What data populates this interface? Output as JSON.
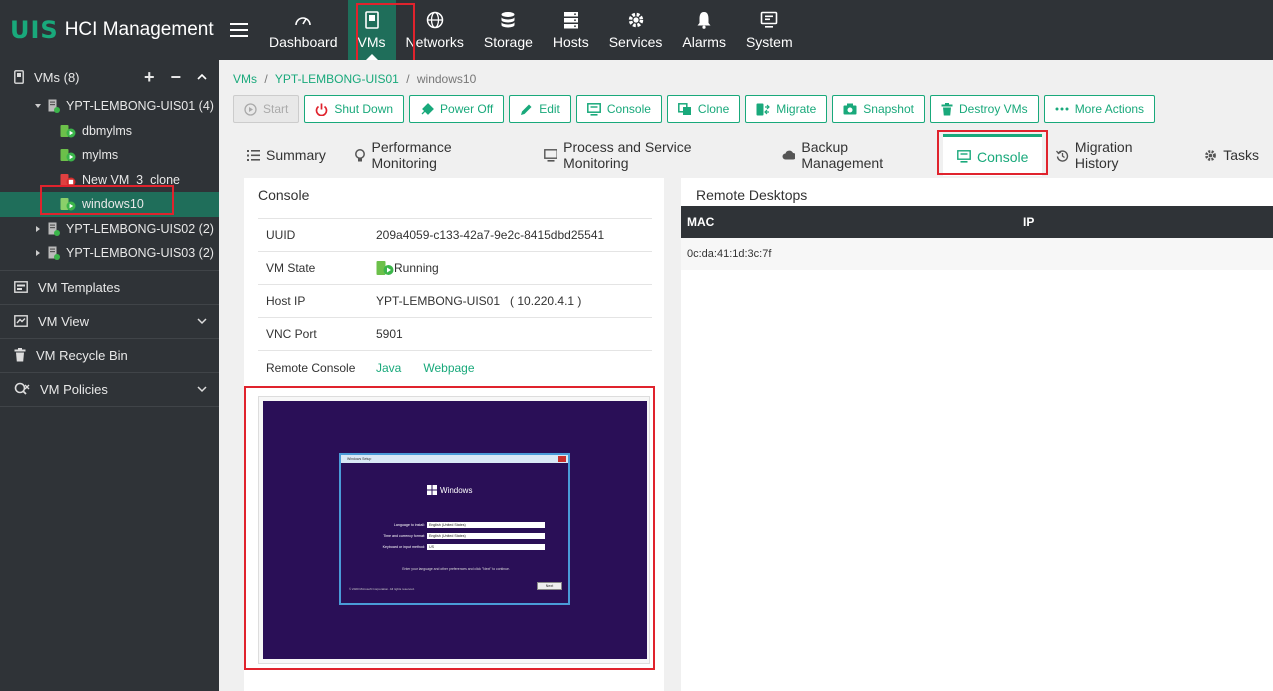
{
  "app": {
    "logo_mark": "UIS",
    "title": "HCI Management"
  },
  "nav": [
    {
      "label": "Dashboard",
      "icon": "dashboard-icon"
    },
    {
      "label": "VMs",
      "icon": "vm-icon",
      "active": true
    },
    {
      "label": "Networks",
      "icon": "globe-icon"
    },
    {
      "label": "Storage",
      "icon": "database-icon"
    },
    {
      "label": "Hosts",
      "icon": "server-icon"
    },
    {
      "label": "Services",
      "icon": "gear-icon"
    },
    {
      "label": "Alarms",
      "icon": "bell-icon"
    },
    {
      "label": "System",
      "icon": "monitor-icon"
    }
  ],
  "sidebar": {
    "vms_label": "VMs (8)",
    "add": "+",
    "remove": "−",
    "hosts": [
      {
        "label": "YPT-LEMBONG-UIS01 (4)",
        "expanded": true
      },
      {
        "label": "YPT-LEMBONG-UIS02 (2)",
        "expanded": false
      },
      {
        "label": "YPT-LEMBONG-UIS03 (2)",
        "expanded": false
      }
    ],
    "vms": [
      {
        "label": "dbmylms",
        "state": "running"
      },
      {
        "label": "mylms",
        "state": "running"
      },
      {
        "label": "New VM_3_clone",
        "state": "stopped"
      },
      {
        "label": "windows10",
        "state": "running",
        "selected": true
      }
    ],
    "sections": [
      {
        "label": "VM Templates",
        "icon": "template-icon"
      },
      {
        "label": "VM View",
        "icon": "view-icon"
      },
      {
        "label": "VM Recycle Bin",
        "icon": "trash-icon"
      },
      {
        "label": "VM Policies",
        "icon": "policy-icon"
      }
    ]
  },
  "breadcrumb": {
    "root": "VMs",
    "sep": "/",
    "host": "YPT-LEMBONG-UIS01",
    "current": "windows10"
  },
  "toolbar": [
    "Start",
    "Shut Down",
    "Power Off",
    "Edit",
    "Console",
    "Clone",
    "Migrate",
    "Snapshot",
    "Destroy VMs",
    "More Actions"
  ],
  "tabs": [
    "Summary",
    "Performance Monitoring",
    "Process and Service Monitoring",
    "Backup Management",
    "Console",
    "Migration History",
    "Tasks"
  ],
  "console": {
    "title": "Console",
    "uuid_label": "UUID",
    "uuid": "209a4059-c133-42a7-9e2c-8415dbd25541",
    "state_label": "VM State",
    "state": "Running",
    "host_ip_label": "Host IP",
    "host_name": "YPT-LEMBONG-UIS01",
    "host_ip": "( 10.220.4.1 )",
    "vnc_label": "VNC Port",
    "vnc_port": "5901",
    "remote_label": "Remote Console",
    "remote_java": "Java",
    "remote_web": "Webpage"
  },
  "setup": {
    "window_title": "Windows Setup",
    "brand": "Windows",
    "language_label": "Language to install:",
    "language_value": "English (United States)",
    "time_label": "Time and currency format:",
    "time_value": "English (United States)",
    "keyboard_label": "Keyboard or input method:",
    "keyboard_value": "US",
    "hint": "Enter your language and other preferences and click \"Next\" to continue.",
    "copyright": "© 2020 Microsoft Corporation. All rights reserved.",
    "next": "Next"
  },
  "remote": {
    "title": "Remote Desktops",
    "col_mac": "MAC",
    "col_ip": "IP",
    "rows": [
      {
        "mac": "0c:da:41:1d:3c:7f",
        "ip": ""
      }
    ]
  },
  "colors": {
    "accent": "#19a97b",
    "topbar": "#2f3337",
    "highlight": "#e0232d",
    "console_bg": "#2a0f57"
  }
}
